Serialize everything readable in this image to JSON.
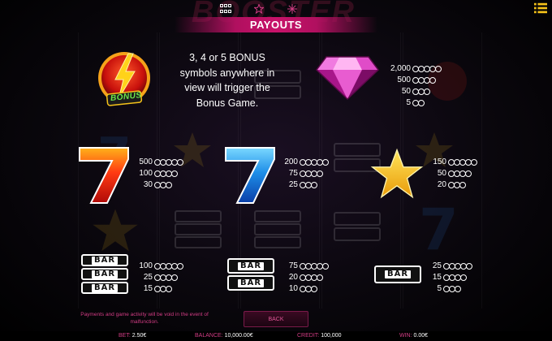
{
  "topbar": {
    "logo_text": "BOOSTER",
    "icons": [
      "grid-icon",
      "star-icon",
      "snowflake-icon",
      "menu-icon"
    ]
  },
  "banner": {
    "title": "PAYOUTS"
  },
  "bonus": {
    "description": "3, 4 or 5 BONUS symbols anywhere in view will trigger the Bonus Game.",
    "badge_text": "BONUS"
  },
  "payouts": {
    "diamond": [
      {
        "value": "2,000",
        "coins": 5
      },
      {
        "value": "500",
        "coins": 4
      },
      {
        "value": "50",
        "coins": 3
      },
      {
        "value": "5",
        "coins": 2
      }
    ],
    "red_seven": [
      {
        "value": "500",
        "coins": 5
      },
      {
        "value": "100",
        "coins": 4
      },
      {
        "value": "30",
        "coins": 3
      }
    ],
    "blue_seven": [
      {
        "value": "200",
        "coins": 5
      },
      {
        "value": "75",
        "coins": 4
      },
      {
        "value": "25",
        "coins": 3
      }
    ],
    "star": [
      {
        "value": "150",
        "coins": 5
      },
      {
        "value": "50",
        "coins": 4
      },
      {
        "value": "20",
        "coins": 3
      }
    ],
    "triple_bar": [
      {
        "value": "100",
        "coins": 5
      },
      {
        "value": "25",
        "coins": 4
      },
      {
        "value": "15",
        "coins": 3
      }
    ],
    "double_bar": [
      {
        "value": "75",
        "coins": 5
      },
      {
        "value": "20",
        "coins": 4
      },
      {
        "value": "10",
        "coins": 3
      }
    ],
    "single_bar": [
      {
        "value": "25",
        "coins": 5
      },
      {
        "value": "15",
        "coins": 4
      },
      {
        "value": "5",
        "coins": 3
      }
    ]
  },
  "bar_label": "BAR",
  "seven_label": "7",
  "footer": {
    "malfunction": "Payments and game activity will be void in the event of malfunction.",
    "back_label": "BACK"
  },
  "status": {
    "bet_label": "BET:",
    "bet_value": "2.50€",
    "balance_label": "BALANCE:",
    "balance_value": "10,000.00€",
    "credit_label": "CREDIT:",
    "credit_value": "100,000",
    "win_label": "WIN:",
    "win_value": "0.00€"
  },
  "colors": {
    "accent": "#c8126a",
    "label_pink": "#d23c84",
    "red_seven": "#e8261b",
    "blue_seven": "#1e8ee8",
    "star": "#f5c21a",
    "diamond": "#e040c8"
  }
}
